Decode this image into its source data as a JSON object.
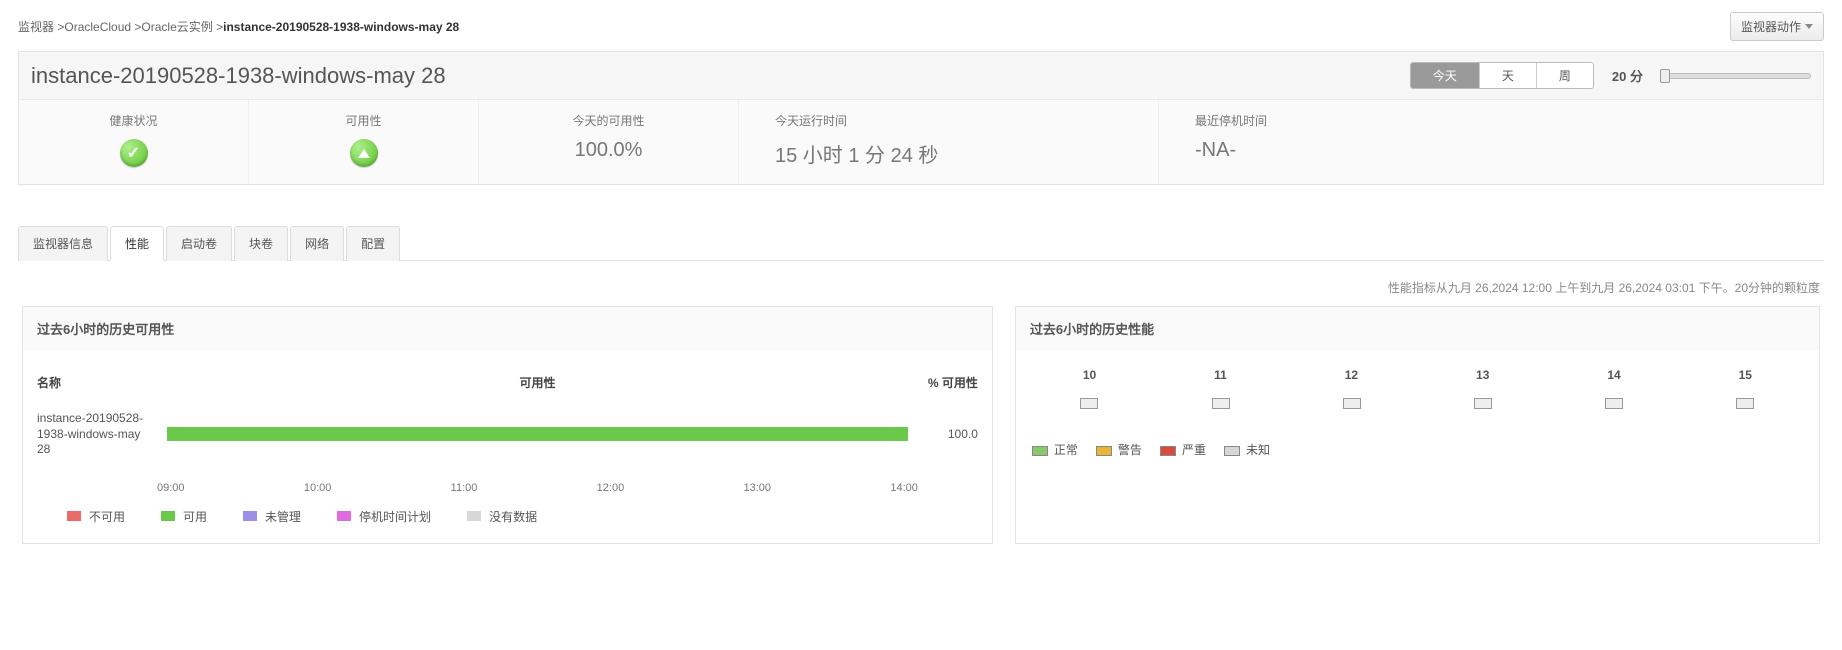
{
  "breadcrumb": {
    "items": [
      "监视器",
      "OracleCloud",
      "Oracle云实例"
    ],
    "current": "instance-20190528-1938-windows-may 28"
  },
  "actions_button": "监视器动作",
  "title": "instance-20190528-1938-windows-may 28",
  "range_tabs": {
    "today": "今天",
    "day": "天",
    "week": "周"
  },
  "granularity": "20 分",
  "stats": {
    "health_label": "健康状况",
    "avail_label": "可用性",
    "today_avail_label": "今天的可用性",
    "today_avail_value": "100.0%",
    "uptime_label": "今天运行时间",
    "uptime_value": "15 小时 1 分 24 秒",
    "downtime_label": "最近停机时间",
    "downtime_value": "-NA-"
  },
  "tabs": {
    "monitor_info": "监视器信息",
    "performance": "性能",
    "boot_volume": "启动卷",
    "block_volume": "块卷",
    "network": "网络",
    "config": "配置"
  },
  "metric_info": "性能指标从九月 26,2024 12:00 上午到九月 26,2024 03:01 下午。20分钟的颗粒度",
  "card_avail": {
    "title": "过去6小时的历史可用性",
    "col_name": "名称",
    "col_avail": "可用性",
    "col_pct": "% 可用性",
    "row_name": "instance-20190528-1938-windows-may 28",
    "row_pct": "100.0",
    "ticks": [
      "09:00",
      "10:00",
      "11:00",
      "12:00",
      "13:00",
      "14:00"
    ],
    "legend": {
      "unavailable": "不可用",
      "available": "可用",
      "unmanaged": "未管理",
      "downtime_plan": "停机时间计划",
      "nodata": "没有数据"
    },
    "colors": {
      "unavailable": "#e86a6a",
      "available": "#6ac84a",
      "unmanaged": "#9a8ee6",
      "downtime_plan": "#e06be0",
      "nodata": "#d7d7d7"
    }
  },
  "card_perf": {
    "title": "过去6小时的历史性能",
    "hours": [
      "10",
      "11",
      "12",
      "13",
      "14",
      "15"
    ],
    "legend": {
      "normal": "正常",
      "warning": "警告",
      "critical": "严重",
      "unknown": "未知"
    },
    "colors": {
      "normal": "#8bc86a",
      "warning": "#e8b43c",
      "critical": "#d84a3a",
      "unknown": "#d7d7d7"
    }
  },
  "chart_data": [
    {
      "type": "bar",
      "title": "过去6小时的历史可用性",
      "categories": [
        "09:00",
        "10:00",
        "11:00",
        "12:00",
        "13:00",
        "14:00"
      ],
      "series": [
        {
          "name": "instance-20190528-1938-windows-may 28",
          "values": [
            100,
            100,
            100,
            100,
            100,
            100
          ],
          "status": "available"
        }
      ],
      "ylabel": "% 可用性",
      "ylim": [
        0,
        100
      ]
    },
    {
      "type": "heatmap",
      "title": "过去6小时的历史性能",
      "categories": [
        "10",
        "11",
        "12",
        "13",
        "14",
        "15"
      ],
      "values": [
        "unknown",
        "unknown",
        "unknown",
        "unknown",
        "unknown",
        "unknown"
      ],
      "legend": [
        "正常",
        "警告",
        "严重",
        "未知"
      ]
    }
  ]
}
